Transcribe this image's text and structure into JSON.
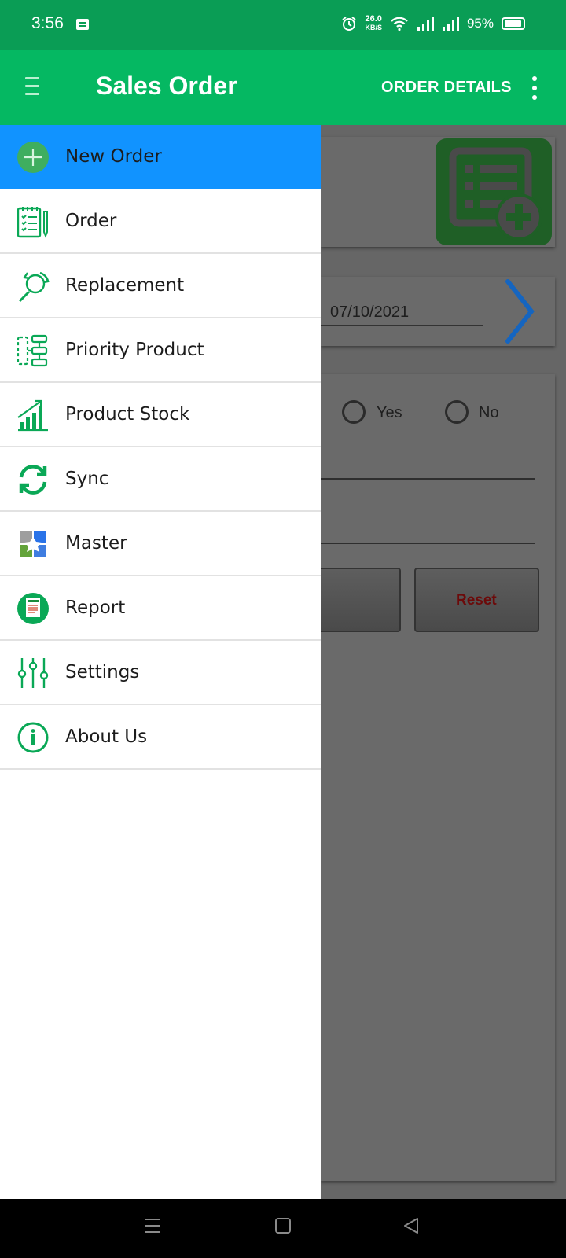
{
  "status_bar": {
    "time": "3:56",
    "speed_value": "26.0",
    "speed_unit": "KB/S",
    "battery": "95%"
  },
  "app_bar": {
    "title": "Sales Order",
    "action_label": "ORDER DETAILS"
  },
  "background": {
    "date": "07/10/2021",
    "radio_yes": "Yes",
    "radio_no": "No",
    "reset_button": "Reset"
  },
  "drawer": {
    "items": [
      {
        "label": "New Order",
        "icon": "add-circle-icon"
      },
      {
        "label": "Order",
        "icon": "clipboard-list-icon"
      },
      {
        "label": "Replacement",
        "icon": "replace-cycle-icon"
      },
      {
        "label": "Priority Product",
        "icon": "flowchart-icon"
      },
      {
        "label": "Product Stock",
        "icon": "growth-chart-icon"
      },
      {
        "label": "Sync",
        "icon": "sync-icon"
      },
      {
        "label": "Master",
        "icon": "puzzle-grid-icon"
      },
      {
        "label": "Report",
        "icon": "report-document-icon"
      },
      {
        "label": "Settings",
        "icon": "sliders-icon"
      },
      {
        "label": "About Us",
        "icon": "info-icon"
      }
    ]
  },
  "colors": {
    "status_bar": "#0a9d55",
    "app_bar": "#05b862",
    "selected_item": "#1193ff",
    "icon_green": "#0aa856",
    "reset_text": "#6c0a0a"
  }
}
